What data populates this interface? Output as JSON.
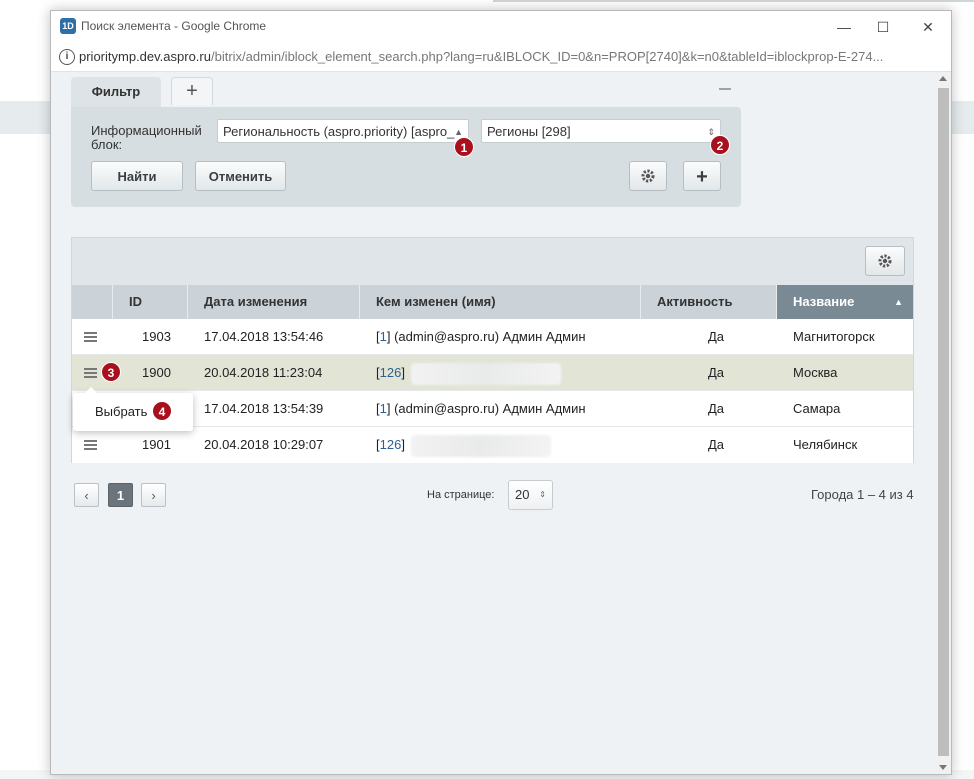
{
  "window": {
    "title": "Поиск элемента - Google Chrome",
    "url_host": "prioritymp.dev.aspro.ru",
    "url_path": "/bitrix/admin/iblock_element_search.php?lang=ru&IBLOCK_ID=0&n=PROP[2740]&k=n0&tableId=iblockprop-E-274...",
    "app_icon_text": "1D",
    "minimize": "—",
    "maximize": "☐",
    "close": "✕"
  },
  "filter": {
    "tab_label": "Фильтр",
    "add_tab_label": "+",
    "iblock_label": "Информационный блок:",
    "iblock_value": "Региональность (aspro.priority) [aspro_",
    "section_value": "Регионы [298]",
    "find_label": "Найти",
    "cancel_label": "Отменить",
    "add_label": "+"
  },
  "badges": [
    "1",
    "2",
    "3",
    "4"
  ],
  "table": {
    "columns": [
      "ID",
      "Дата изменения",
      "Кем изменен (имя)",
      "Активность",
      "Название"
    ],
    "sort_indicator": "▲",
    "rows": [
      {
        "id": "1903",
        "date": "17.04.2018 13:54:46",
        "user_id": "1",
        "user_name": "(admin@aspro.ru) Админ Админ",
        "active": "Да",
        "name": "Магнитогорск"
      },
      {
        "id": "1900",
        "date": "20.04.2018 11:23:04",
        "user_id": "126",
        "user_name": "",
        "active": "Да",
        "name": "Москва"
      },
      {
        "id": "",
        "date": "17.04.2018 13:54:39",
        "user_id": "1",
        "user_name": "(admin@aspro.ru) Админ Админ",
        "active": "Да",
        "name": "Самара"
      },
      {
        "id": "1901",
        "date": "20.04.2018 10:29:07",
        "user_id": "126",
        "user_name": "",
        "active": "Да",
        "name": "Челябинск"
      }
    ],
    "popup_item": "Выбрать"
  },
  "pager": {
    "prev": "‹",
    "current": "1",
    "next": "›",
    "per_page_label": "На странице:",
    "per_page_value": "20",
    "range_text": "Города 1 – 4 из 4"
  }
}
